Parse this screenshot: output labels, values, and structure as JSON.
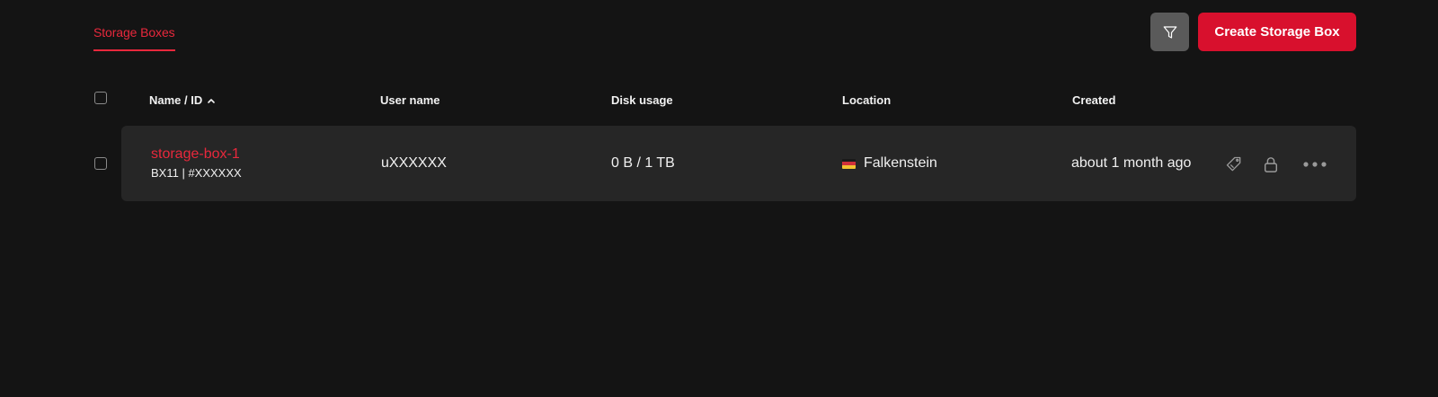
{
  "tabs": [
    {
      "label": "Storage Boxes",
      "active": true
    }
  ],
  "toolbar": {
    "filter_icon": "filter-icon",
    "create_label": "Create Storage Box"
  },
  "table": {
    "columns": [
      "Name / ID",
      "User name",
      "Disk usage",
      "Location",
      "Created"
    ],
    "sort": {
      "column": "Name / ID",
      "direction": "asc"
    },
    "rows": [
      {
        "name": "storage-box-1",
        "id_line": "BX11 | #XXXXXX",
        "user_name": "uXXXXXX",
        "disk_usage": "0 B / 1 TB",
        "location": "Falkenstein",
        "location_flag": "germany-flag-icon",
        "created": "about 1 month ago",
        "actions": [
          "edit-tag-icon",
          "lock-icon",
          "more-icon"
        ]
      }
    ]
  },
  "colors": {
    "background": "#141414",
    "row_background": "#262626",
    "accent": "#d8102d",
    "accent_text": "#e8283c",
    "filter_button": "#5a5a5a"
  }
}
